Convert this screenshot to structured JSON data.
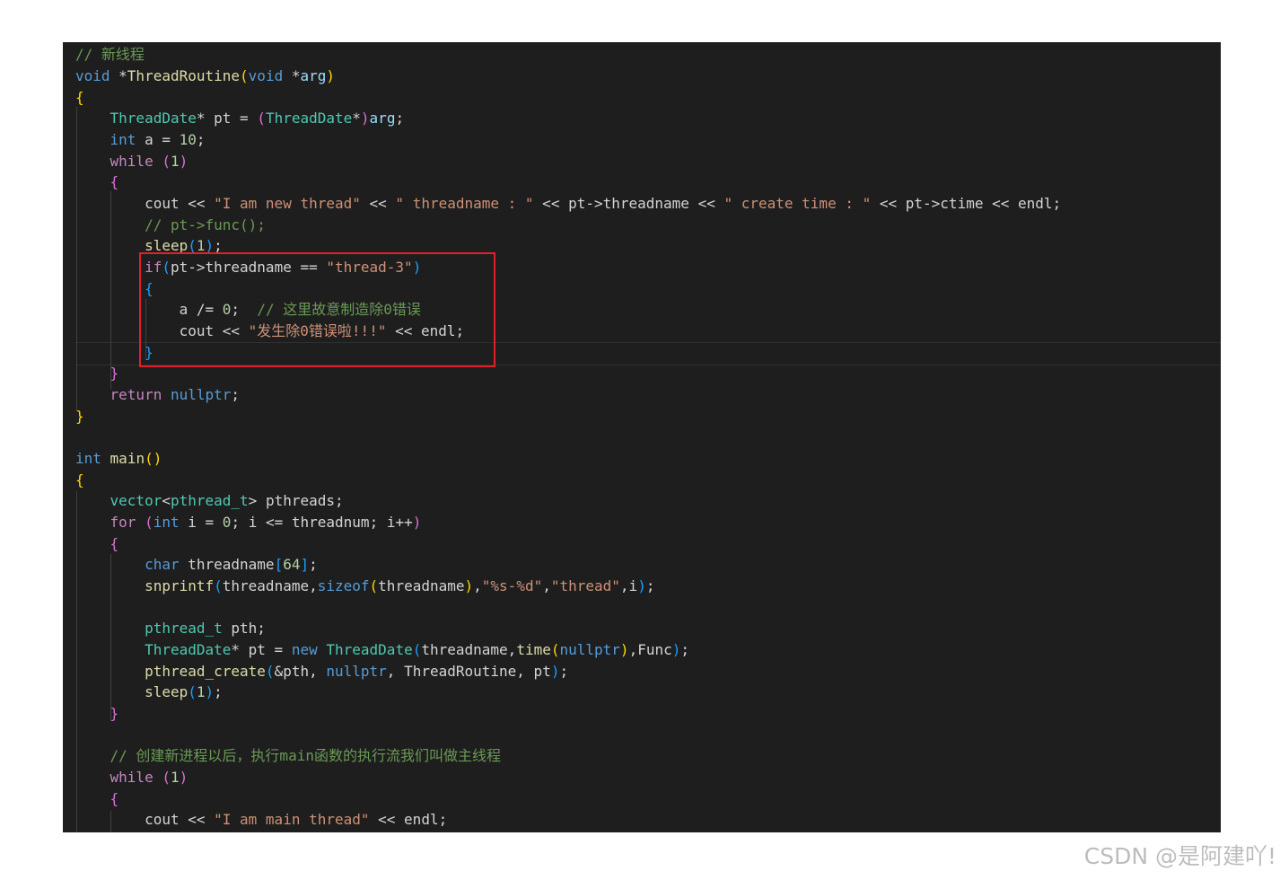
{
  "colors": {
    "background": "#1e1e1e",
    "default": "#d4d4d4",
    "keyword": "#569cd6",
    "control": "#c586c0",
    "type": "#4ec9b0",
    "function": "#dcdcaa",
    "variable": "#9cdcfe",
    "string": "#ce9178",
    "number": "#b5cea8",
    "comment": "#6a9955",
    "bracket1": "#ffd700",
    "bracket2": "#da70d6",
    "bracket3": "#179fff",
    "highlight": "#e0202a"
  },
  "code_lines": [
    [
      [
        "// 新线程",
        "comment"
      ]
    ],
    [
      [
        "void",
        "keyword"
      ],
      [
        " *",
        ""
      ],
      [
        "ThreadRoutine",
        "function"
      ],
      [
        "(",
        "bracket1"
      ],
      [
        "void",
        "keyword"
      ],
      [
        " *",
        ""
      ],
      [
        "arg",
        "variable"
      ],
      [
        ")",
        "bracket1"
      ]
    ],
    [
      [
        "{",
        "bracket1"
      ]
    ],
    [
      [
        "    ",
        ""
      ],
      [
        "ThreadDate",
        "type"
      ],
      [
        "* pt = ",
        ""
      ],
      [
        "(",
        "bracket2"
      ],
      [
        "ThreadDate",
        "type"
      ],
      [
        "*",
        ""
      ],
      [
        ")",
        "bracket2"
      ],
      [
        "arg",
        "variable"
      ],
      [
        ";",
        ""
      ]
    ],
    [
      [
        "    ",
        ""
      ],
      [
        "int",
        "keyword"
      ],
      [
        " a = ",
        ""
      ],
      [
        "10",
        "number"
      ],
      [
        ";",
        ""
      ]
    ],
    [
      [
        "    ",
        ""
      ],
      [
        "while",
        "control"
      ],
      [
        " ",
        ""
      ],
      [
        "(",
        "bracket2"
      ],
      [
        "1",
        "number"
      ],
      [
        ")",
        "bracket2"
      ]
    ],
    [
      [
        "    ",
        ""
      ],
      [
        "{",
        "bracket2"
      ]
    ],
    [
      [
        "        cout << ",
        ""
      ],
      [
        "\"I am new thread\"",
        "string"
      ],
      [
        " << ",
        ""
      ],
      [
        "\" threadname : \"",
        "string"
      ],
      [
        " << pt->threadname << ",
        ""
      ],
      [
        "\" create time : \"",
        "string"
      ],
      [
        " << pt->ctime << endl;",
        ""
      ]
    ],
    [
      [
        "        ",
        ""
      ],
      [
        "// pt->func();",
        "comment"
      ]
    ],
    [
      [
        "        ",
        ""
      ],
      [
        "sleep",
        "function"
      ],
      [
        "(",
        "bracket3"
      ],
      [
        "1",
        "number"
      ],
      [
        ")",
        "bracket3"
      ],
      [
        ";",
        ""
      ]
    ],
    [
      [
        "        ",
        ""
      ],
      [
        "if",
        "control"
      ],
      [
        "(",
        "bracket3"
      ],
      [
        "pt->threadname == ",
        ""
      ],
      [
        "\"thread-3\"",
        "string"
      ],
      [
        ")",
        "bracket3"
      ]
    ],
    [
      [
        "        ",
        ""
      ],
      [
        "{",
        "bracket3"
      ]
    ],
    [
      [
        "            a /= ",
        ""
      ],
      [
        "0",
        "number"
      ],
      [
        ";  ",
        ""
      ],
      [
        "// 这里故意制造除0错误",
        "comment"
      ]
    ],
    [
      [
        "            cout << ",
        ""
      ],
      [
        "\"发生除0错误啦!!!\"",
        "string"
      ],
      [
        " << endl;",
        ""
      ]
    ],
    [
      [
        "        ",
        ""
      ],
      [
        "}",
        "bracket3"
      ]
    ],
    [
      [
        "    ",
        ""
      ],
      [
        "}",
        "bracket2"
      ]
    ],
    [
      [
        "    ",
        ""
      ],
      [
        "return",
        "control"
      ],
      [
        " ",
        ""
      ],
      [
        "nullptr",
        "keyword"
      ],
      [
        ";",
        ""
      ]
    ],
    [
      [
        "}",
        "bracket1"
      ]
    ],
    [],
    [
      [
        "int",
        "keyword"
      ],
      [
        " ",
        ""
      ],
      [
        "main",
        "function"
      ],
      [
        "()",
        "bracket1"
      ]
    ],
    [
      [
        "{",
        "bracket1"
      ]
    ],
    [
      [
        "    ",
        ""
      ],
      [
        "vector",
        "type"
      ],
      [
        "<",
        ""
      ],
      [
        "pthread_t",
        "type"
      ],
      [
        "> pthreads;",
        ""
      ]
    ],
    [
      [
        "    ",
        ""
      ],
      [
        "for",
        "control"
      ],
      [
        " ",
        ""
      ],
      [
        "(",
        "bracket2"
      ],
      [
        "int",
        "keyword"
      ],
      [
        " i = ",
        ""
      ],
      [
        "0",
        "number"
      ],
      [
        "; i <= threadnum; i++",
        ""
      ],
      [
        ")",
        "bracket2"
      ]
    ],
    [
      [
        "    ",
        ""
      ],
      [
        "{",
        "bracket2"
      ]
    ],
    [
      [
        "        ",
        ""
      ],
      [
        "char",
        "keyword"
      ],
      [
        " threadname",
        ""
      ],
      [
        "[",
        "bracket3"
      ],
      [
        "64",
        "number"
      ],
      [
        "]",
        "bracket3"
      ],
      [
        ";",
        ""
      ]
    ],
    [
      [
        "        ",
        ""
      ],
      [
        "snprintf",
        "function"
      ],
      [
        "(",
        "bracket3"
      ],
      [
        "threadname,",
        ""
      ],
      [
        "sizeof",
        "keyword"
      ],
      [
        "(",
        "bracket1"
      ],
      [
        "threadname",
        ""
      ],
      [
        ")",
        "bracket1"
      ],
      [
        ",",
        ""
      ],
      [
        "\"%s-%d\"",
        "string"
      ],
      [
        ",",
        ""
      ],
      [
        "\"thread\"",
        "string"
      ],
      [
        ",i",
        ""
      ],
      [
        ")",
        "bracket3"
      ],
      [
        ";",
        ""
      ]
    ],
    [],
    [
      [
        "        ",
        ""
      ],
      [
        "pthread_t",
        "type"
      ],
      [
        " pth;",
        ""
      ]
    ],
    [
      [
        "        ",
        ""
      ],
      [
        "ThreadDate",
        "type"
      ],
      [
        "* pt = ",
        ""
      ],
      [
        "new",
        "keyword"
      ],
      [
        " ",
        ""
      ],
      [
        "ThreadDate",
        "type"
      ],
      [
        "(",
        "bracket3"
      ],
      [
        "threadname,",
        ""
      ],
      [
        "time",
        "function"
      ],
      [
        "(",
        "bracket1"
      ],
      [
        "nullptr",
        "keyword"
      ],
      [
        ")",
        "bracket1"
      ],
      [
        ",Func",
        ""
      ],
      [
        ")",
        "bracket3"
      ],
      [
        ";",
        ""
      ]
    ],
    [
      [
        "        ",
        ""
      ],
      [
        "pthread_create",
        "function"
      ],
      [
        "(",
        "bracket3"
      ],
      [
        "&pth, ",
        ""
      ],
      [
        "nullptr",
        "keyword"
      ],
      [
        ", ThreadRoutine, pt",
        ""
      ],
      [
        ")",
        "bracket3"
      ],
      [
        ";",
        ""
      ]
    ],
    [
      [
        "        ",
        ""
      ],
      [
        "sleep",
        "function"
      ],
      [
        "(",
        "bracket3"
      ],
      [
        "1",
        "number"
      ],
      [
        ")",
        "bracket3"
      ],
      [
        ";",
        ""
      ]
    ],
    [
      [
        "    ",
        ""
      ],
      [
        "}",
        "bracket2"
      ]
    ],
    [],
    [
      [
        "    ",
        ""
      ],
      [
        "// 创建新进程以后，执行main函数的执行流我们叫做主线程",
        "comment"
      ]
    ],
    [
      [
        "    ",
        ""
      ],
      [
        "while",
        "control"
      ],
      [
        " ",
        ""
      ],
      [
        "(",
        "bracket2"
      ],
      [
        "1",
        "number"
      ],
      [
        ")",
        "bracket2"
      ]
    ],
    [
      [
        "    ",
        ""
      ],
      [
        "{",
        "bracket2"
      ]
    ],
    [
      [
        "        cout << ",
        ""
      ],
      [
        "\"I am main thread\"",
        "string"
      ],
      [
        " << endl;",
        ""
      ]
    ]
  ],
  "watermark": "CSDN @是阿建吖!"
}
